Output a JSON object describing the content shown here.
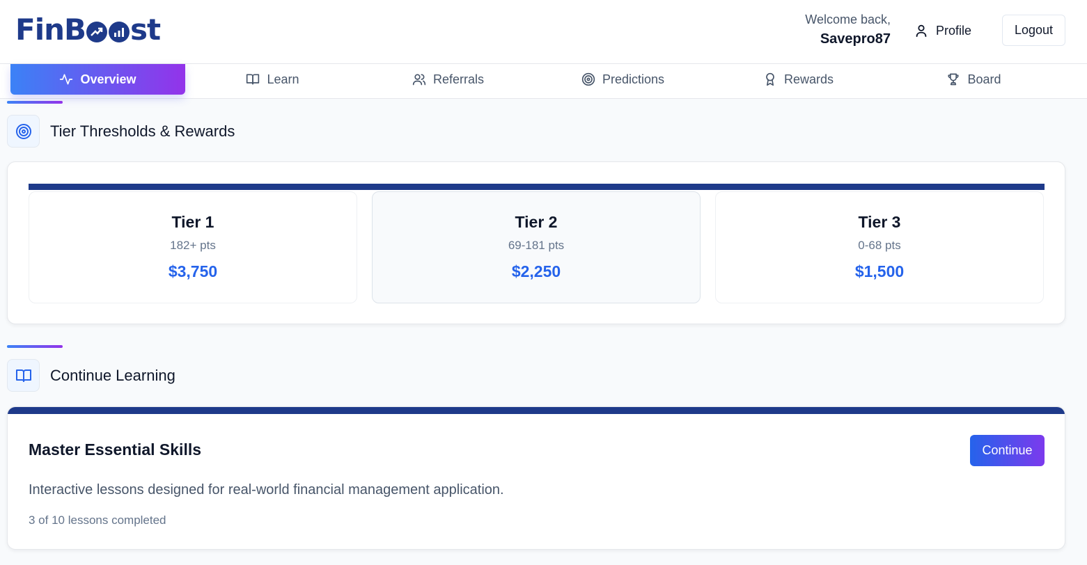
{
  "brand": {
    "name_part1": "FinB",
    "name_part2": "st",
    "logo_icon": "growth-chart-icon"
  },
  "header": {
    "welcome_text": "Welcome back,",
    "username": "Savepro87",
    "profile_label": "Profile",
    "logout_label": "Logout"
  },
  "nav": {
    "tabs": [
      {
        "label": "Overview",
        "icon": "activity-icon",
        "active": true
      },
      {
        "label": "Learn",
        "icon": "book-icon",
        "active": false
      },
      {
        "label": "Referrals",
        "icon": "users-icon",
        "active": false
      },
      {
        "label": "Predictions",
        "icon": "target-icon",
        "active": false
      },
      {
        "label": "Rewards",
        "icon": "award-icon",
        "active": false
      },
      {
        "label": "Board",
        "icon": "trophy-icon",
        "active": false
      }
    ]
  },
  "tiers_section": {
    "title": "Tier Thresholds & Rewards",
    "icon": "target-icon",
    "tiers": [
      {
        "name": "Tier 1",
        "points": "182+ pts",
        "amount": "$3,750"
      },
      {
        "name": "Tier 2",
        "points": "69-181 pts",
        "amount": "$2,250",
        "highlighted": true
      },
      {
        "name": "Tier 3",
        "points": "0-68 pts",
        "amount": "$1,500"
      }
    ]
  },
  "learning_section": {
    "title": "Continue Learning",
    "icon": "book-icon",
    "card": {
      "title": "Master Essential Skills",
      "description": "Interactive lessons designed for real-world financial management application.",
      "progress_text": "3 of 10 lessons completed",
      "lessons_completed": 3,
      "lessons_total": 10,
      "button_label": "Continue"
    }
  },
  "colors": {
    "brand_navy": "#1e3a8a",
    "accent_blue": "#2563eb",
    "gradient_start": "#3b82f6",
    "gradient_end": "#9333ea"
  }
}
